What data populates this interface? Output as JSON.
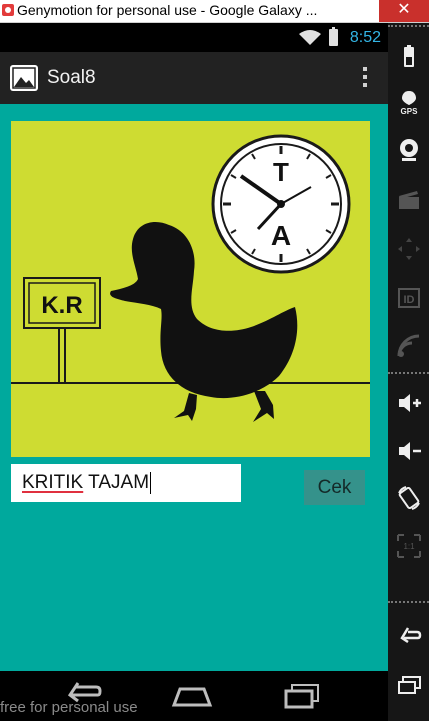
{
  "window": {
    "title": "Genymotion for personal use - Google Galaxy ...",
    "close_glyph": "✕"
  },
  "status_bar": {
    "time": "8:52",
    "time_color": "#33b5e5"
  },
  "action_bar": {
    "app_title": "Soal8"
  },
  "puzzle": {
    "sign_text": "K.R",
    "clock_letter_top": "T",
    "clock_letter_bottom": "A"
  },
  "answer_input": {
    "value_word1": "KRITIK",
    "value_word2": " TAJAM"
  },
  "check_button": {
    "label": "Cek"
  },
  "watermark": {
    "text": "free for personal use"
  },
  "side_panel": {
    "gps_label": "GPS",
    "id_label": "ID",
    "scale_label": "1:1"
  },
  "colors": {
    "content_bg": "#00a99d",
    "puzzle_bg": "#cedc32",
    "button_bg": "#35928b"
  }
}
